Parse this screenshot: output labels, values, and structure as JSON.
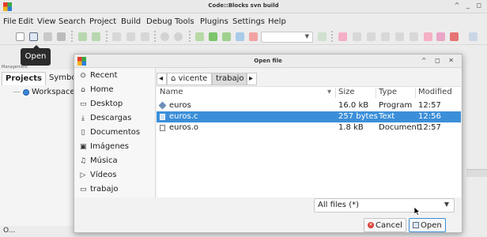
{
  "app": {
    "title": "Code::Blocks svn build",
    "window_buttons": "^ _ ◻"
  },
  "menu": [
    "File",
    "Edit",
    "View",
    "Search",
    "Project",
    "Build",
    "Debug",
    "Tools",
    "Plugins",
    "Settings",
    "Help"
  ],
  "tooltip": "Open",
  "management_label": "Management",
  "left_panel": {
    "tabs": [
      "Projects",
      "Symbo"
    ],
    "workspace": "Workspace"
  },
  "status": "O...",
  "dialog": {
    "title": "Open file",
    "window_buttons": "^ ◻ ✕",
    "places": [
      {
        "icon": "clock-icon",
        "glyph": "⊙",
        "label": "Recent"
      },
      {
        "icon": "home-icon",
        "glyph": "⌂",
        "label": "Home"
      },
      {
        "icon": "folder-icon",
        "glyph": "▭",
        "label": "Desktop"
      },
      {
        "icon": "download-icon",
        "glyph": "⤓",
        "label": "Descargas"
      },
      {
        "icon": "folder-icon",
        "glyph": "▯",
        "label": "Documentos"
      },
      {
        "icon": "image-icon",
        "glyph": "▣",
        "label": "Imágenes"
      },
      {
        "icon": "music-icon",
        "glyph": "♫",
        "label": "Música"
      },
      {
        "icon": "video-icon",
        "glyph": "▷",
        "label": "Vídeos"
      },
      {
        "icon": "folder-icon",
        "glyph": "▭",
        "label": "trabajo"
      }
    ],
    "path": {
      "back": "◂",
      "home_glyph": "⌂",
      "segments": [
        "vicente",
        "trabajo"
      ],
      "forward": "▸"
    },
    "columns": {
      "name": "Name",
      "size": "Size",
      "type": "Type",
      "modified": "Modified",
      "sort_arrow": "▾"
    },
    "files": [
      {
        "name": "euros",
        "size": "16.0 kB",
        "type": "Program",
        "modified": "12:57",
        "icon": "executable-icon",
        "selected": false
      },
      {
        "name": "euros.c",
        "size": "257 bytes",
        "type": "Text",
        "modified": "12:56",
        "icon": "text-file-icon",
        "selected": true
      },
      {
        "name": "euros.o",
        "size": "1.8 kB",
        "type": "Document",
        "modified": "12:57",
        "icon": "document-icon",
        "selected": false
      }
    ],
    "filter": "All files (*)",
    "buttons": {
      "cancel": "Cancel",
      "open": "Open"
    }
  }
}
